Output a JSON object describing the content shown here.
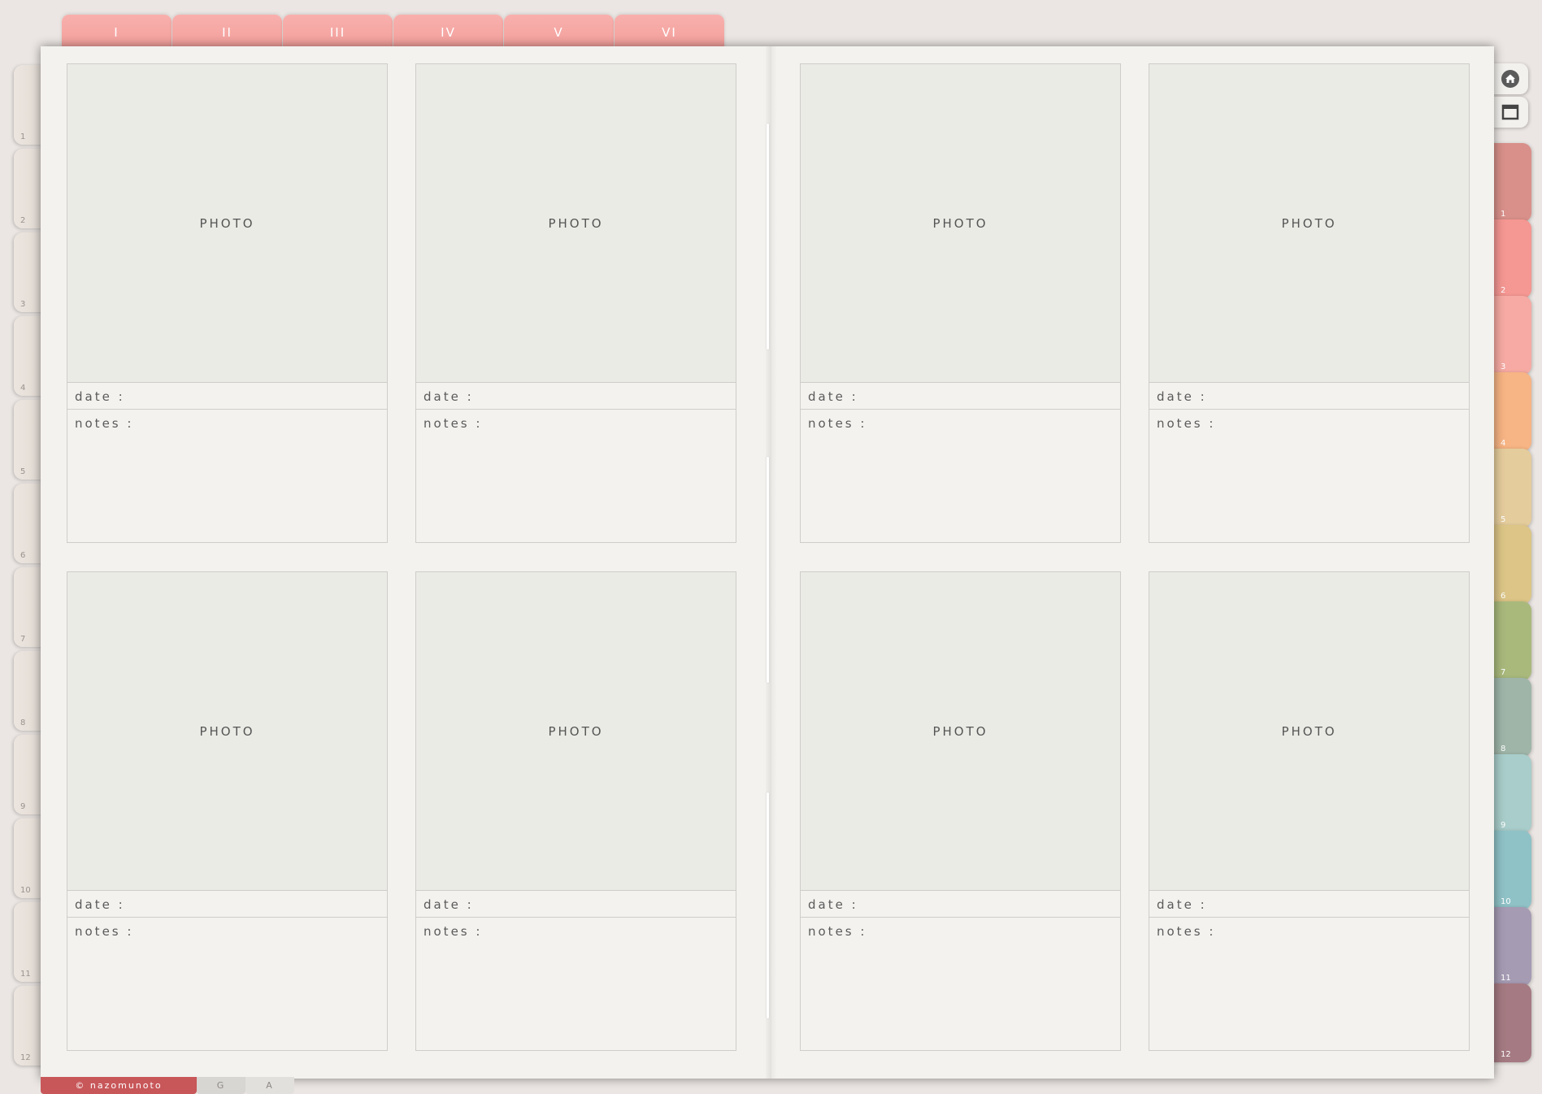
{
  "top_tabs": [
    "I",
    "II",
    "III",
    "IV",
    "V",
    "VI"
  ],
  "left_tabs": [
    "1",
    "2",
    "3",
    "4",
    "5",
    "6",
    "7",
    "8",
    "9",
    "10",
    "11",
    "12"
  ],
  "right_tabs": [
    {
      "label": "1",
      "color": "#d9908a"
    },
    {
      "label": "2",
      "color": "#f59792"
    },
    {
      "label": "3",
      "color": "#f6aaa3"
    },
    {
      "label": "4",
      "color": "#f7b484"
    },
    {
      "label": "5",
      "color": "#e5cc9c"
    },
    {
      "label": "6",
      "color": "#dcc586"
    },
    {
      "label": "7",
      "color": "#a9b97c"
    },
    {
      "label": "8",
      "color": "#9fb5a8"
    },
    {
      "label": "9",
      "color": "#a8cdca"
    },
    {
      "label": "10",
      "color": "#8fc2c7"
    },
    {
      "label": "11",
      "color": "#a59bb3"
    },
    {
      "label": "12",
      "color": "#a57a82"
    }
  ],
  "icons": {
    "home": "home-icon",
    "window": "window-icon"
  },
  "cards": [
    {
      "photo": "PHOTO",
      "date": "date :",
      "notes": "notes :"
    },
    {
      "photo": "PHOTO",
      "date": "date :",
      "notes": "notes :"
    },
    {
      "photo": "PHOTO",
      "date": "date :",
      "notes": "notes :"
    },
    {
      "photo": "PHOTO",
      "date": "date :",
      "notes": "notes :"
    },
    {
      "photo": "PHOTO",
      "date": "date :",
      "notes": "notes :"
    },
    {
      "photo": "PHOTO",
      "date": "date :",
      "notes": "notes :"
    },
    {
      "photo": "PHOTO",
      "date": "date :",
      "notes": "notes :"
    },
    {
      "photo": "PHOTO",
      "date": "date :",
      "notes": "notes :"
    }
  ],
  "bottom_tabs": [
    {
      "label": "© nazomunoto",
      "color": "#c8575a"
    },
    {
      "label": "G",
      "color": "#d8d6d3"
    },
    {
      "label": "A",
      "color": "#e2e0dd"
    }
  ]
}
